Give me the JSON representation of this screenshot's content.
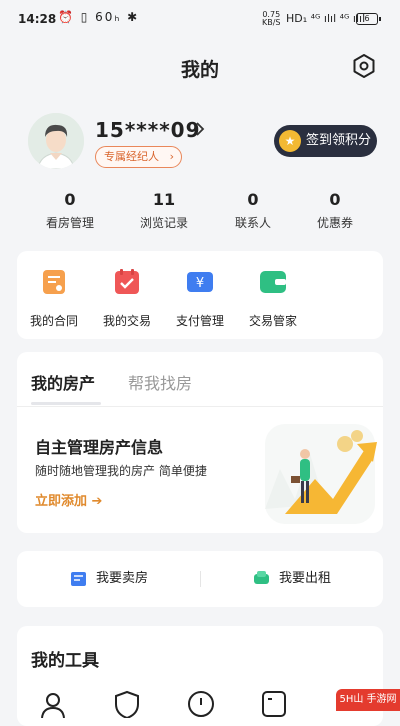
{
  "status_bar": {
    "time": "14:28",
    "left_icons": "⏰ ▯ 60ₕ ✱",
    "speed_value": "0.75",
    "speed_unit": "KB/S",
    "network": "HD₁ ⁴ᴳ ılıl ⁴ᴳ ılıl",
    "battery": "6"
  },
  "header": {
    "title": "我的"
  },
  "profile": {
    "phone": "15****09",
    "agent_badge": "专属经纪人",
    "agent_arrow": "›",
    "signin_label": "签到领积分",
    "signin_icon_glyph": "★"
  },
  "stats": [
    {
      "value": "0",
      "label": "看房管理"
    },
    {
      "value": "11",
      "label": "浏览记录"
    },
    {
      "value": "0",
      "label": "联系人"
    },
    {
      "value": "0",
      "label": "优惠券"
    }
  ],
  "quick_actions": [
    {
      "label": "我的合同",
      "icon": "contract-icon",
      "color": "#f6a04d"
    },
    {
      "label": "我的交易",
      "icon": "transaction-icon",
      "color": "#ef5757"
    },
    {
      "label": "支付管理",
      "icon": "payment-icon",
      "color": "#3f7df0"
    },
    {
      "label": "交易管家",
      "icon": "wallet-icon",
      "color": "#2fbf83"
    }
  ],
  "property_section": {
    "tabs": [
      "我的房产",
      "帮我找房"
    ],
    "title": "自主管理房产信息",
    "subtitle": "随时随地管理我的房产 简单便捷",
    "link": "立即添加 ➔"
  },
  "actions": {
    "sell": "我要卖房",
    "rent": "我要出租"
  },
  "tools": {
    "title": "我的工具"
  },
  "corner_logo": "5H山 手游网",
  "colors": {
    "accent_orange": "#e08a2d",
    "badge_orange": "#d9652d",
    "signin_bg": "#2a2f3f",
    "coin": "#f3b933"
  }
}
